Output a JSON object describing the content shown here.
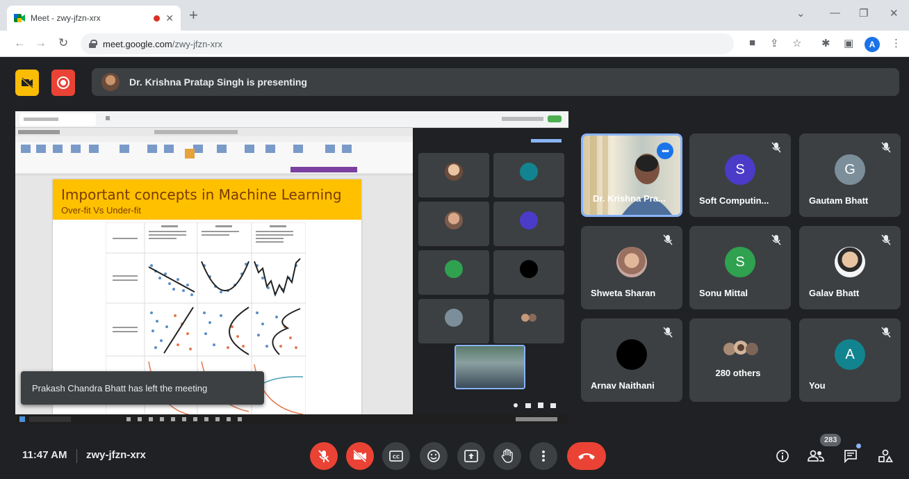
{
  "browser": {
    "tab_title": "Meet - zwy-jfzn-xrx",
    "url_host": "meet.google.com",
    "url_path": "/zwy-jfzn-xrx",
    "profile_initial": "A"
  },
  "meet": {
    "presenting_text": "Dr. Krishna Pratap Singh is presenting",
    "toast_text": "Prakash Chandra Bhatt has left the meeting",
    "time": "11:47 AM",
    "meeting_code": "zwy-jfzn-xrx",
    "participant_count": "283"
  },
  "slide": {
    "title": "Important concepts in Machine Learning",
    "subtitle": "Over-fit Vs Under-fit"
  },
  "participants": [
    {
      "name": "Dr. Krishna Pra...",
      "type": "video"
    },
    {
      "name": "Soft Computin...",
      "initial": "S",
      "color": "#4b3bc9"
    },
    {
      "name": "Gautam Bhatt",
      "initial": "G",
      "color": "#7b8e99"
    },
    {
      "name": "Shweta Sharan",
      "type": "photo"
    },
    {
      "name": "Sonu Mittal",
      "initial": "S",
      "color": "#2fa14f"
    },
    {
      "name": "Galav Bhatt",
      "type": "photo"
    },
    {
      "name": "Arnav Naithani",
      "type": "dark"
    },
    {
      "name": "280 others",
      "type": "group"
    },
    {
      "name": "You",
      "initial": "A",
      "color": "#12848f"
    }
  ],
  "colors": {
    "accent_blue": "#8ab4f8",
    "danger_red": "#ea4335",
    "tile_bg": "#3c4043",
    "page_bg": "#202124",
    "slide_header": "#ffc000"
  }
}
